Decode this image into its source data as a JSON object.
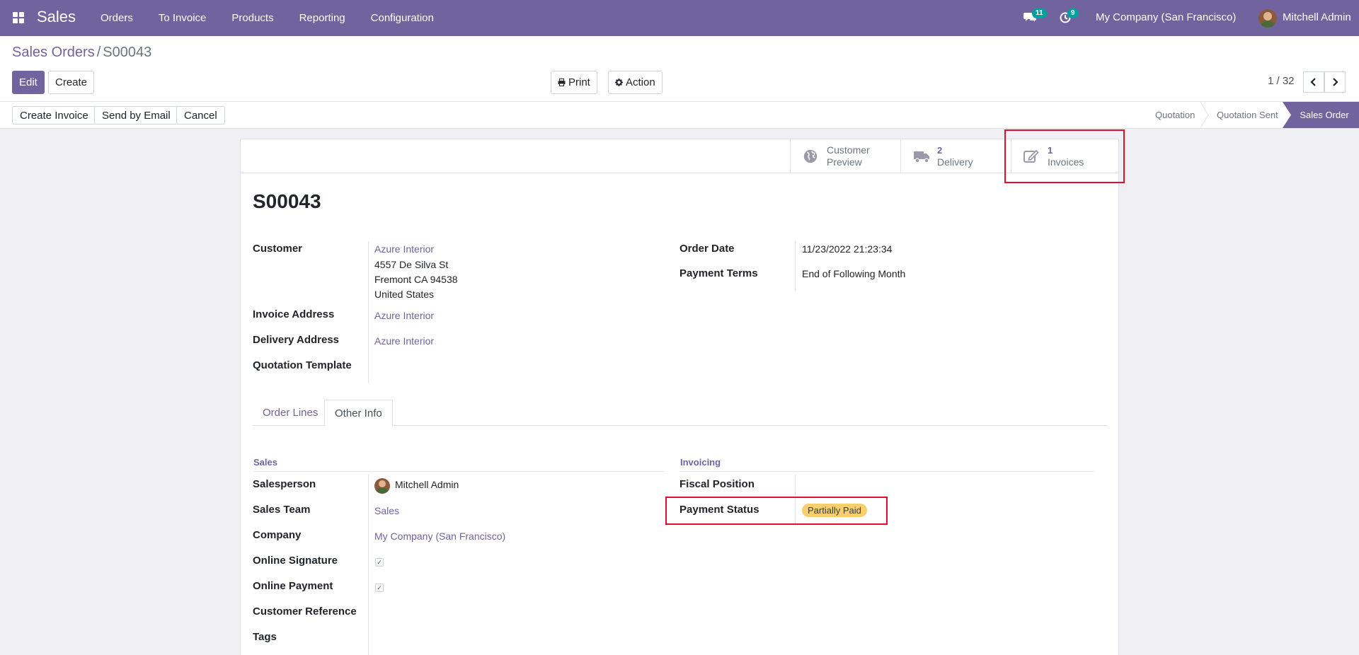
{
  "navbar": {
    "app_name": "Sales",
    "menu": [
      "Orders",
      "To Invoice",
      "Products",
      "Reporting",
      "Configuration"
    ],
    "messages_count": "11",
    "activities_count": "9",
    "company": "My Company (San Francisco)",
    "user": "Mitchell Admin"
  },
  "breadcrumb": {
    "parent": "Sales Orders",
    "separator": "/",
    "current": "S00043"
  },
  "toolbar": {
    "edit": "Edit",
    "create": "Create",
    "print": "Print",
    "action": "Action",
    "pager": "1 / 32"
  },
  "statusbar": {
    "buttons": [
      "Create Invoice",
      "Send by Email",
      "Cancel"
    ],
    "stages": [
      "Quotation",
      "Quotation Sent",
      "Sales Order"
    ],
    "active_stage": "Sales Order"
  },
  "smart_buttons": {
    "preview_line1": "Customer",
    "preview_line2": "Preview",
    "delivery_count": "2",
    "delivery_label": "Delivery",
    "invoices_count": "1",
    "invoices_label": "Invoices"
  },
  "record": {
    "name": "S00043",
    "customer_label": "Customer",
    "customer": "Azure Interior",
    "address_line1": "4557 De Silva St",
    "address_line2": "Fremont CA 94538",
    "address_line3": "United States",
    "invoice_address_label": "Invoice Address",
    "invoice_address": "Azure Interior",
    "delivery_address_label": "Delivery Address",
    "delivery_address": "Azure Interior",
    "quotation_template_label": "Quotation Template",
    "order_date_label": "Order Date",
    "order_date": "11/23/2022 21:23:34",
    "payment_terms_label": "Payment Terms",
    "payment_terms": "End of Following Month"
  },
  "tabs": [
    "Order Lines",
    "Other Info"
  ],
  "other_info": {
    "sales_section": "Sales",
    "salesperson_label": "Salesperson",
    "salesperson": "Mitchell Admin",
    "sales_team_label": "Sales Team",
    "sales_team": "Sales",
    "company_label": "Company",
    "company": "My Company (San Francisco)",
    "online_signature_label": "Online Signature",
    "online_payment_label": "Online Payment",
    "customer_reference_label": "Customer Reference",
    "tags_label": "Tags",
    "invoicing_section": "Invoicing",
    "fiscal_position_label": "Fiscal Position",
    "payment_status_label": "Payment Status",
    "payment_status": "Partially Paid"
  },
  "colors": {
    "brand": "#71639e",
    "highlight": "#e0102a",
    "status_pill": "#f9cf6d"
  }
}
